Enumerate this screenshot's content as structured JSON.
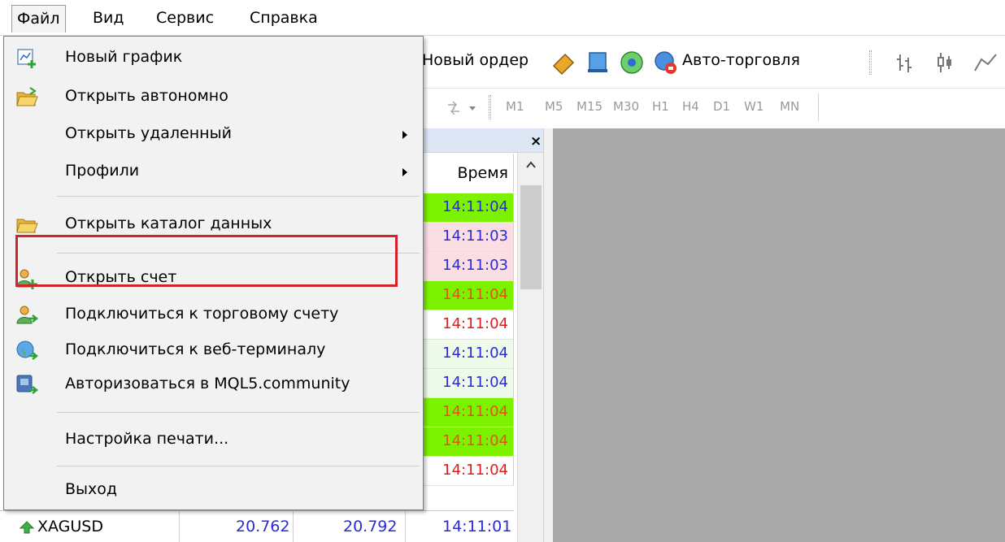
{
  "menubar": {
    "items": [
      "Файл",
      "Вид",
      "Сервис",
      "Справка"
    ]
  },
  "toolbar": {
    "new_order": "Новый ордер",
    "auto_trading": "Авто-торговля"
  },
  "timeframes": [
    "M1",
    "M5",
    "M15",
    "M30",
    "H1",
    "H4",
    "D1",
    "W1",
    "MN"
  ],
  "file_menu": {
    "items": [
      {
        "label": "Новый график",
        "icon": "new-chart-icon"
      },
      {
        "label": "Открыть автономно",
        "icon": "open-folder-icon"
      },
      {
        "label": "Открыть удаленный",
        "submenu": true
      },
      {
        "label": "Профили",
        "submenu": true
      },
      {
        "label": "Открыть каталог данных",
        "icon": "folder-icon",
        "highlighted": true
      },
      {
        "label": "Открыть счет",
        "icon": "user-add-icon"
      },
      {
        "label": "Подключиться к торговому счету",
        "icon": "user-connect-icon"
      },
      {
        "label": "Подключиться к веб-терминалу",
        "icon": "web-globe-icon"
      },
      {
        "label": "Авторизоваться в MQL5.community",
        "icon": "mql5-icon"
      },
      {
        "label": "Настройка печати..."
      },
      {
        "label": "Выход"
      }
    ]
  },
  "market_watch": {
    "close": "×",
    "time_header": "Время",
    "times": [
      {
        "value": "14:11:04",
        "bg": "#7cf200",
        "color": "#2a2ad8"
      },
      {
        "value": "14:11:03",
        "bg": "#fbdde4",
        "color": "#2a2ad8"
      },
      {
        "value": "14:11:03",
        "bg": "#fbdde4",
        "color": "#2a2ad8"
      },
      {
        "value": "14:11:04",
        "bg": "#7cf200",
        "color": "#e4521b"
      },
      {
        "value": "14:11:04",
        "bg": "#ffffff",
        "color": "#e11b1b"
      },
      {
        "value": "14:11:04",
        "bg": "#eefbea",
        "color": "#2a2ad8"
      },
      {
        "value": "14:11:04",
        "bg": "#eefbea",
        "color": "#2a2ad8"
      },
      {
        "value": "14:11:04",
        "bg": "#7cf200",
        "color": "#e4521b"
      },
      {
        "value": "14:11:04",
        "bg": "#7cf200",
        "color": "#e4521b"
      },
      {
        "value": "14:11:04",
        "bg": "#ffffff",
        "color": "#e11b1b"
      }
    ],
    "last_row": {
      "symbol": "XAGUSD",
      "bid": "20.762",
      "ask": "20.792",
      "time": "14:11:01"
    }
  }
}
